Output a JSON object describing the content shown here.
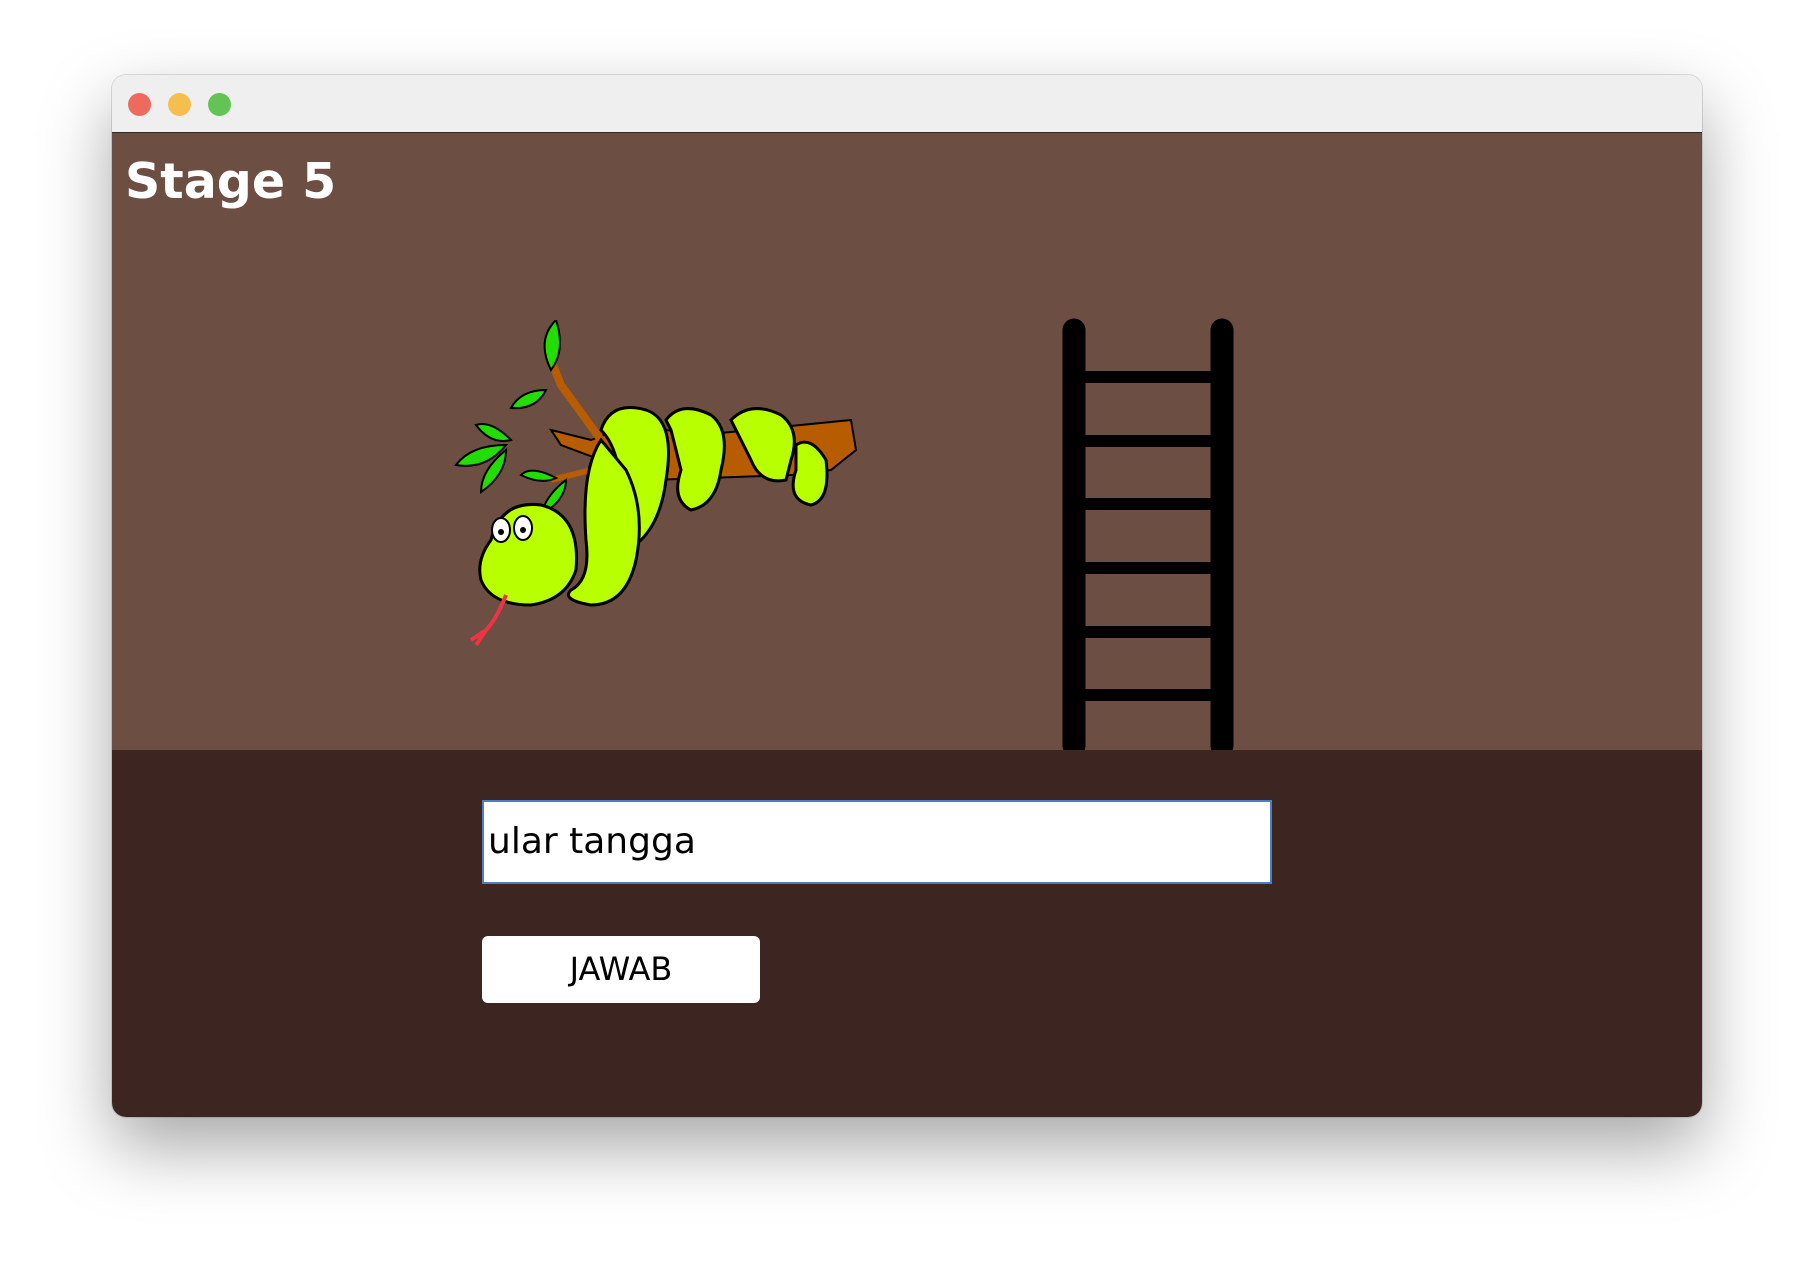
{
  "window": {
    "controls": [
      "close",
      "minimize",
      "zoom"
    ]
  },
  "stage": {
    "title": "Stage 5",
    "images": [
      "snake-on-branch",
      "ladder"
    ]
  },
  "answer": {
    "value": "ular tangga",
    "button_label": "JAWAB"
  },
  "colors": {
    "stage_bg": "#6d4e42",
    "bottom_bg": "#3d2522",
    "snake": "#b8ff00",
    "leaf": "#22dd00",
    "branch": "#b85c00"
  }
}
